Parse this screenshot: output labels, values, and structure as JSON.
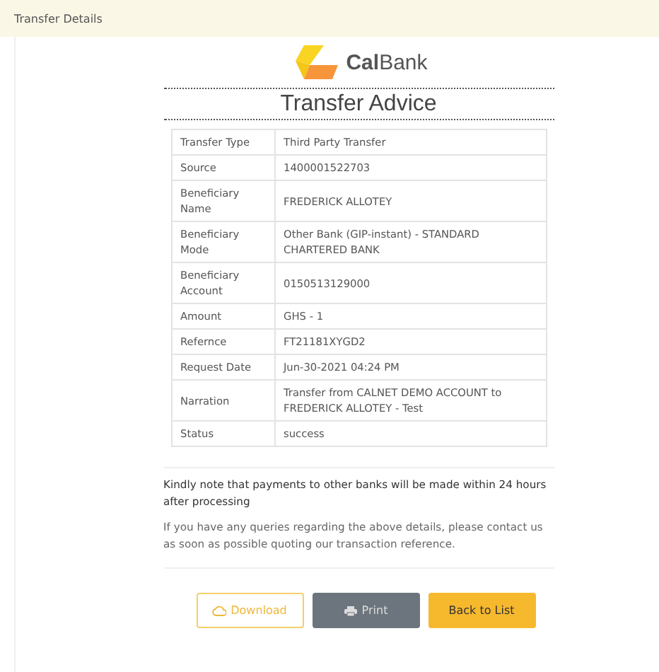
{
  "header": {
    "title": "Transfer Details"
  },
  "logo": {
    "name_bold": "Cal",
    "name_rest": "Bank"
  },
  "title": "Transfer Advice",
  "details": [
    {
      "label": "Transfer Type",
      "value": "Third Party Transfer"
    },
    {
      "label": "Source",
      "value": "1400001522703"
    },
    {
      "label": "Beneficiary Name",
      "value": "FREDERICK ALLOTEY"
    },
    {
      "label": "Beneficiary Mode",
      "value": "Other Bank (GIP-instant) - STANDARD CHARTERED BANK"
    },
    {
      "label": "Beneficiary Account",
      "value": "0150513129000"
    },
    {
      "label": "Amount",
      "value": "GHS - 1"
    },
    {
      "label": "Refernce",
      "value": "FT21181XYGD2"
    },
    {
      "label": "Request Date",
      "value": "Jun-30-2021 04:24 PM"
    },
    {
      "label": "Narration",
      "value": "Transfer from CALNET DEMO ACCOUNT to FREDERICK ALLOTEY - Test"
    },
    {
      "label": "Status",
      "value": "success"
    }
  ],
  "notes": [
    "Kindly note that payments to other banks will be made within 24 hours after processing",
    "If you have any queries regarding the above details, please contact us as soon as possible quoting our transaction reference."
  ],
  "buttons": [
    {
      "kind": "download",
      "label": "Download"
    },
    {
      "kind": "print",
      "label": "Print"
    },
    {
      "kind": "back",
      "label": "Back to List"
    }
  ]
}
